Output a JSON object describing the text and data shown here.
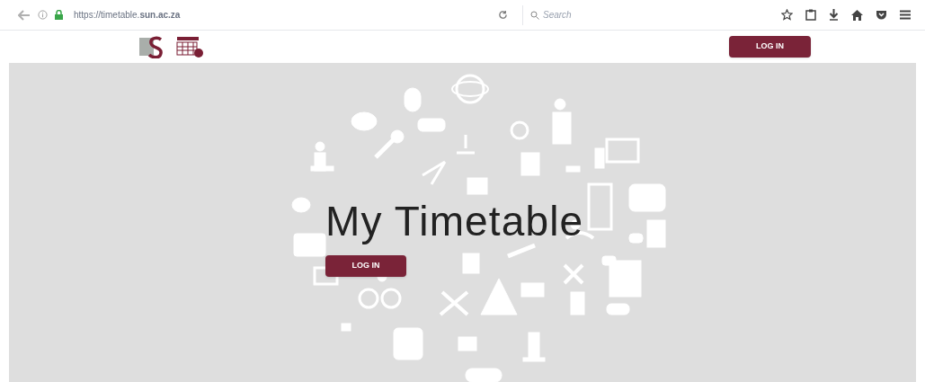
{
  "browser": {
    "url": "https://timetable.**sun.ac.za**",
    "search": {
      "placeholder": "Search"
    }
  },
  "header": {
    "login_button": "LOG IN"
  },
  "hero": {
    "title": "My Timetable",
    "login_button": "LOG IN"
  }
}
